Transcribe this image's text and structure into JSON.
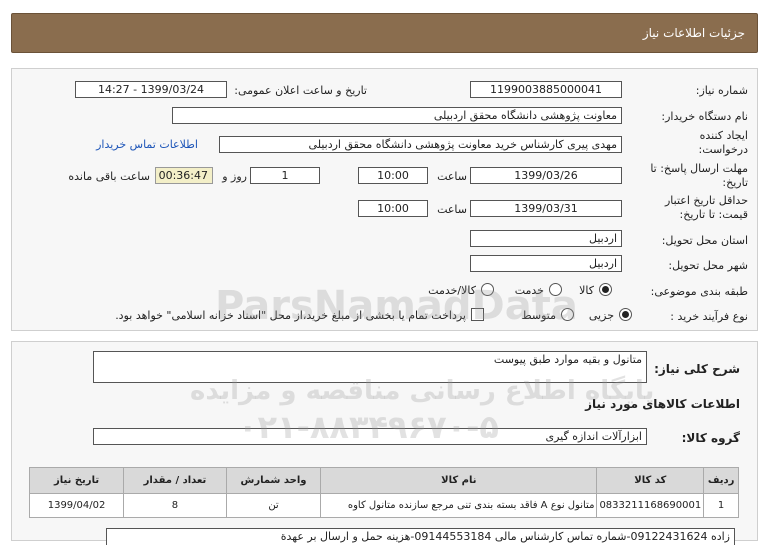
{
  "header": {
    "title": "جزئیات اطلاعات نیاز"
  },
  "fields": {
    "need_number_label": "شماره نیاز:",
    "need_number": "1199003885000041",
    "announce_label": "تاریخ و ساعت اعلان عمومی:",
    "announce_value": "1399/03/24 - 14:27",
    "buyer_label": "نام دستگاه خریدار:",
    "buyer_value": "معاونت پژوهشی دانشگاه محقق اردبیلی",
    "creator_label": "ایجاد کننده درخواست:",
    "creator_value": "مهدی پیری کارشناس خرید معاونت پژوهشی دانشگاه محقق اردبیلی",
    "contact_link": "اطلاعات تماس خریدار",
    "deadline_label": "مهلت ارسال پاسخ: تا تاریخ:",
    "deadline_date": "1399/03/26",
    "time_label": "ساعت",
    "deadline_time": "10:00",
    "days_value": "1",
    "days_label": "روز و",
    "remaining_value": "00:36:47",
    "remaining_label": "ساعت باقی مانده",
    "validity_label": "حداقل تاریخ اعتبار قیمت: تا تاریخ:",
    "validity_date": "1399/03/31",
    "validity_time": "10:00",
    "province_label": "استان محل تحویل:",
    "province_value": "اردبیل",
    "city_label": "شهر محل تحویل:",
    "city_value": "اردبیل",
    "category_label": "طبقه بندی موضوعی:",
    "category_options": [
      "کالا",
      "خدمت",
      "کالا/خدمت"
    ],
    "category_selected": "کالا",
    "process_label": "نوع فرآیند خرید :",
    "process_options": [
      "جزیی",
      "متوسط"
    ],
    "process_selected": "جزیی",
    "payment_note": "پرداخت تمام یا بخشی از مبلغ خرید،از محل \"اسناد خزانه اسلامی\" خواهد بود."
  },
  "description": {
    "label": "شرح کلی نیاز:",
    "value": "متانول و بقیه موارد طبق پیوست"
  },
  "goods_section": {
    "title": "اطلاعات کالاهای مورد نیاز"
  },
  "goods_group": {
    "label": "گروه کالا:",
    "value": "ابزارآلات اندازه گیری"
  },
  "table": {
    "headers": [
      "ردیف",
      "کد کالا",
      "نام کالا",
      "واحد شمارش",
      "تعداد / مقدار",
      "تاریخ نیاز"
    ],
    "rows": [
      [
        "1",
        "0833211168690001",
        "متانول نوع A فاقد بسته بندی تنی مرجع سازنده متانول کاوه",
        "تن",
        "8",
        "1399/04/02"
      ]
    ]
  },
  "footer_note": "زاده 09122431624-شماره تماس کارشناس مالی 09144553184-هزینه حمل و ارسال بر عهدة",
  "watermark": {
    "brand": "ParsNamadData",
    "line1": "پایگاه اطلاع رسانی مناقصه و مزایده",
    "phone": "۰۲۱-۸۸۳۴۹۶۷۰-۵"
  },
  "colors": {
    "header": "#8a6d4e",
    "link": "#1d55b8",
    "remaining_bg": "#f3efc8"
  }
}
